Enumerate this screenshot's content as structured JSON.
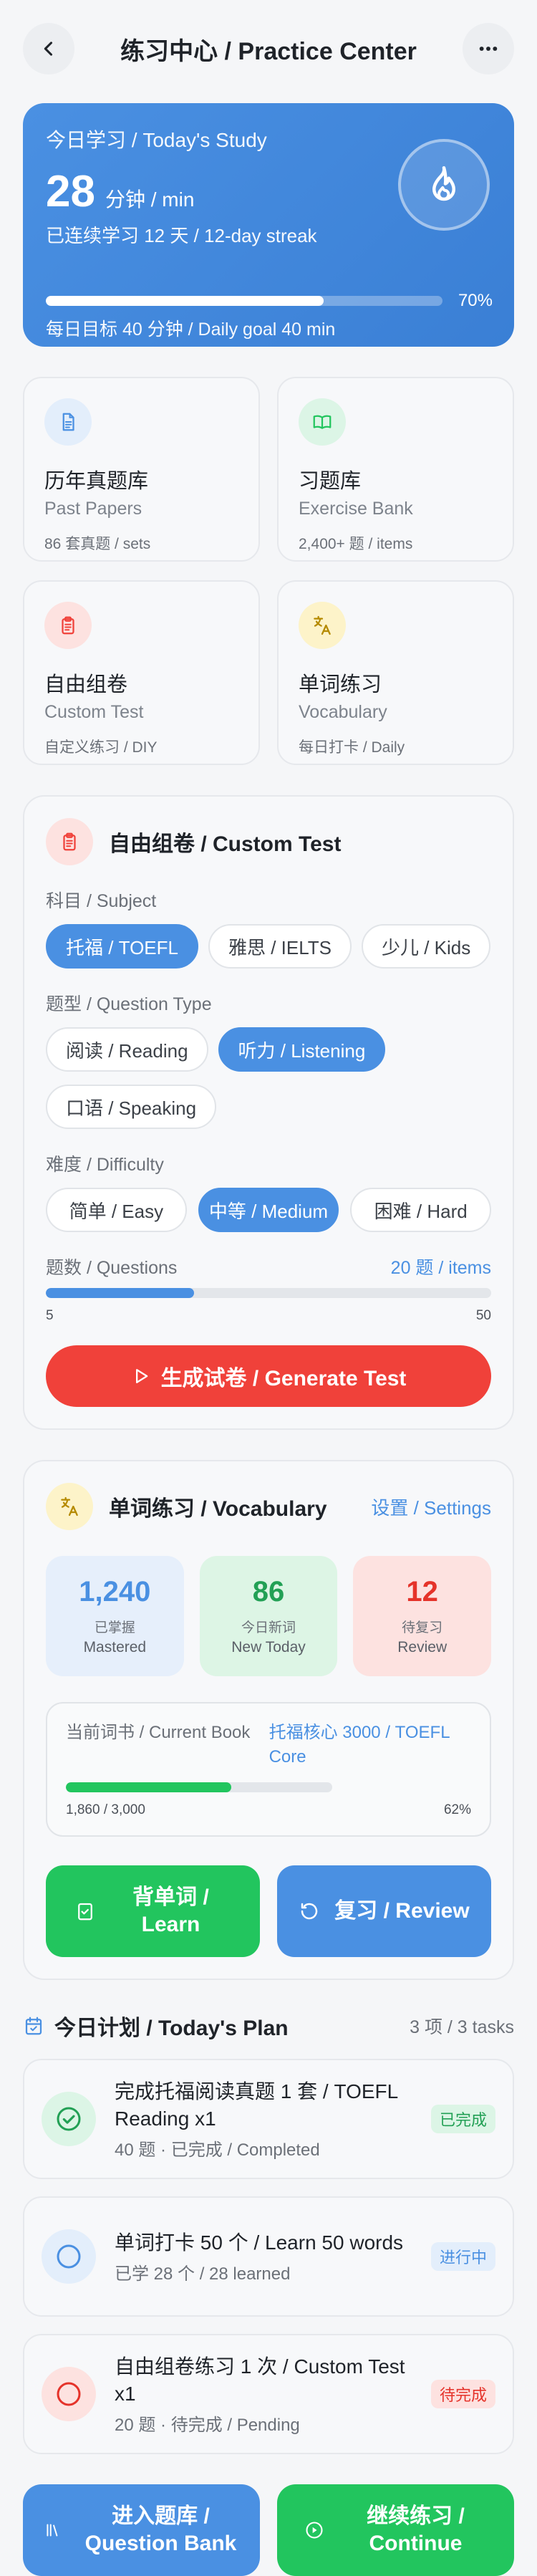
{
  "header": {
    "title": "练习中心 / Practice Center",
    "back_icon": "chevron-left-icon",
    "more_icon": "more-horizontal-icon"
  },
  "hero": {
    "label": "今日学习 / Today's Study",
    "minutes": "28",
    "unit": "分钟 / min",
    "streak": "已连续学习 12 天 / 12-day streak",
    "progress": 0.7,
    "progress_text": "70%",
    "goal": "每日目标 40 分钟 / Daily goal 40 min",
    "icon": "flame-icon"
  },
  "features": [
    {
      "title": "历年真题库",
      "subtitle": "Past Papers",
      "meta": "86 套真题 / sets",
      "icon": "document-icon",
      "color": "#4a90e2",
      "bg": "#e3eefb"
    },
    {
      "title": "习题库",
      "subtitle": "Exercise Bank",
      "meta": "2,400+ 题 / items",
      "icon": "book-open-icon",
      "color": "#22c55e",
      "bg": "#dcf5e6"
    },
    {
      "title": "自由组卷",
      "subtitle": "Custom Test",
      "meta": "自定义练习 / DIY",
      "icon": "clipboard-icon",
      "color": "#f0413a",
      "bg": "#fde2e0"
    },
    {
      "title": "单词练习",
      "subtitle": "Vocabulary",
      "meta": "每日打卡 / Daily",
      "icon": "translate-icon",
      "color": "#b58a00",
      "bg": "#fdf3c9"
    }
  ],
  "custom_test": {
    "title": "自由组卷 / Custom Test",
    "subject_label": "科目 / Subject",
    "subjects": [
      "托福 / TOEFL",
      "雅思 / IELTS",
      "少儿 / Kids"
    ],
    "subject_selected": 0,
    "type_label": "题型 / Question Type",
    "types": [
      "阅读 / Reading",
      "听力 / Listening",
      "口语 / Speaking"
    ],
    "type_selected": 1,
    "difficulty_label": "难度 / Difficulty",
    "difficulties": [
      "简单 / Easy",
      "中等 / Medium",
      "困难 / Hard"
    ],
    "difficulty_selected": 1,
    "questions_label": "题数 / Questions",
    "questions_value": "20 题 / items",
    "questions_count": 20,
    "slider_min": "5",
    "slider_max": "50",
    "generate_label": "生成试卷 / Generate Test"
  },
  "vocabulary": {
    "title": "单词练习 / Vocabulary",
    "settings_label": "设置 / Settings",
    "stats": [
      {
        "num": "1,240",
        "l1": "已掌握",
        "l2": "Mastered",
        "color": "#4a90e2",
        "bg": "#e6effb"
      },
      {
        "num": "86",
        "l1": "今日新词",
        "l2": "New Today",
        "color": "#22a055",
        "bg": "#ddf5e5"
      },
      {
        "num": "12",
        "l1": "待复习",
        "l2": "Review",
        "color": "#e5332a",
        "bg": "#fde2e0"
      }
    ],
    "book_label": "当前词书 / Current Book",
    "book_name": "托福核心 3000 / TOEFL Core",
    "book_progress": "1,860 / 3,000",
    "book_pct": "62%",
    "book_fraction": 0.62,
    "learn_label": "背单词 / Learn",
    "review_label": "复习 / Review"
  },
  "plan": {
    "title": "今日计划 / Today's Plan",
    "count": "3 项 / 3 tasks",
    "tasks": [
      {
        "title": "完成托福阅读真题 1 套 / TOEFL Reading x1",
        "sub": "40 题 · 已完成 / Completed",
        "badge": "已完成",
        "state": "done",
        "color": "#22a055",
        "bg": "#dcf5e6"
      },
      {
        "title": "单词打卡 50 个 / Learn 50 words",
        "sub": "已学 28 个 / 28 learned",
        "badge": "进行中",
        "state": "progress",
        "color": "#4a90e2",
        "bg": "#e3eefb"
      },
      {
        "title": "自由组卷练习 1 次 / Custom Test x1",
        "sub": "20 题 · 待完成 / Pending",
        "badge": "待完成",
        "state": "pending",
        "color": "#e5332a",
        "bg": "#fde2e0"
      }
    ]
  },
  "bottom": {
    "bank_label": "进入题库 / Question Bank",
    "continue_label": "继续练习 / Continue"
  }
}
